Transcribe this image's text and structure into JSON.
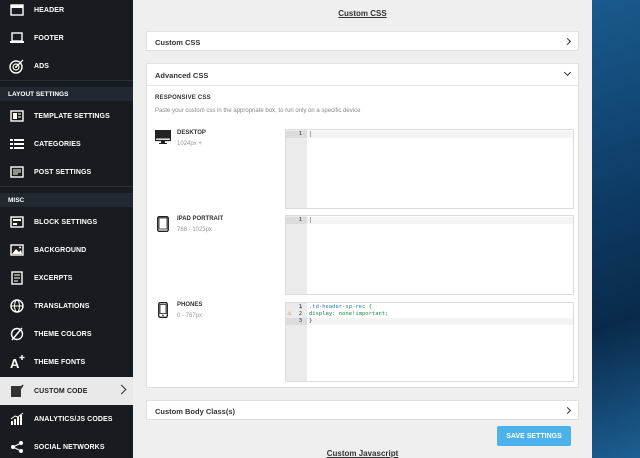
{
  "sidebar": {
    "items": [
      {
        "label": "HEADER",
        "icon": "header-icon"
      },
      {
        "label": "FOOTER",
        "icon": "footer-icon"
      },
      {
        "label": "ADS",
        "icon": "ads-icon"
      },
      {
        "label": "TEMPLATE SETTINGS",
        "icon": "template-icon"
      },
      {
        "label": "CATEGORIES",
        "icon": "categories-icon"
      },
      {
        "label": "POST SETTINGS",
        "icon": "post-settings-icon"
      },
      {
        "label": "BLOCK SETTINGS",
        "icon": "block-settings-icon"
      },
      {
        "label": "BACKGROUND",
        "icon": "background-icon"
      },
      {
        "label": "EXCERPTS",
        "icon": "excerpts-icon"
      },
      {
        "label": "TRANSLATIONS",
        "icon": "globe-icon"
      },
      {
        "label": "THEME COLORS",
        "icon": "theme-colors-icon"
      },
      {
        "label": "THEME FONTS",
        "icon": "theme-fonts-icon"
      },
      {
        "label": "CUSTOM CODE",
        "icon": "custom-code-icon"
      },
      {
        "label": "ANALYTICS/JS CODES",
        "icon": "analytics-icon"
      },
      {
        "label": "SOCIAL NETWORKS",
        "icon": "share-icon"
      }
    ],
    "section_layout": "LAYOUT SETTINGS",
    "section_misc": "MISC"
  },
  "main": {
    "title": "Custom CSS",
    "custom_css_label": "Custom CSS",
    "advanced_css_label": "Advanced CSS",
    "responsive_title": "RESPONSIVE CSS",
    "responsive_desc": "Paste your custom css in the appropriate box, to run only on a specific device",
    "devices": [
      {
        "name": "DESKTOP",
        "range": "1024px +"
      },
      {
        "name": "IPAD PORTRAIT",
        "range": "768 - 1023px"
      },
      {
        "name": "PHONES",
        "range": "0 - 767px"
      }
    ],
    "editors": {
      "desktop_line": "1",
      "ipad_line": "1",
      "phone_lines": [
        "1",
        "2",
        "3"
      ],
      "phone_code": [
        ".td-header-sp-rec {",
        "display: none!important;",
        "}"
      ]
    },
    "custom_body_class_label": "Custom Body Class(s)",
    "save_label": "SAVE SETTINGS",
    "custom_js_label": "Custom Javascript"
  },
  "colors": {
    "accent": "#4db2ec",
    "sidebar_bg": "#181c20",
    "active_bg": "#e9e9e9"
  }
}
